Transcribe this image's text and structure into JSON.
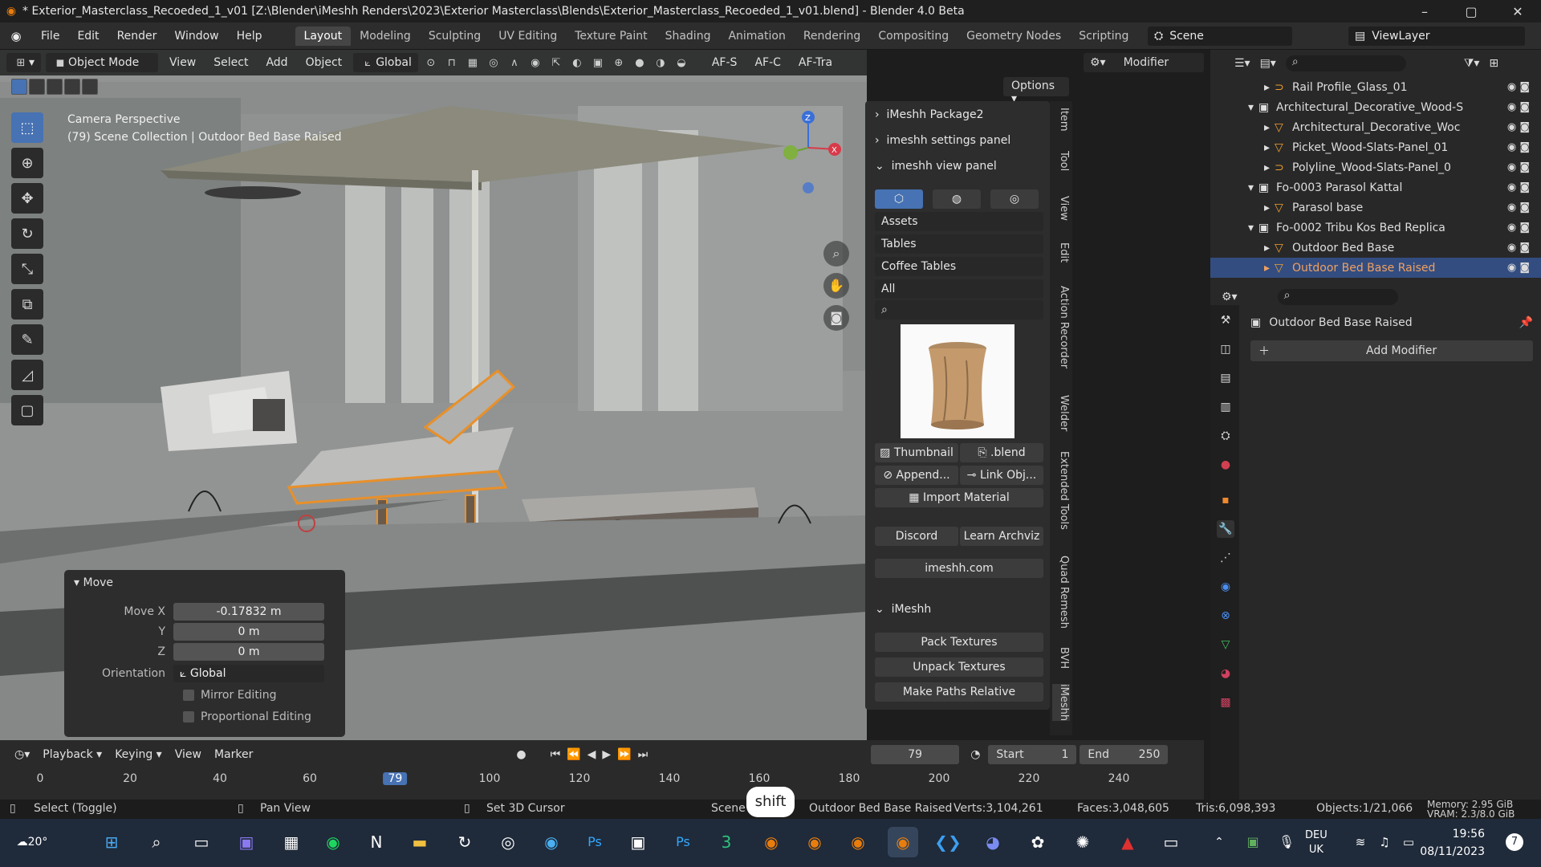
{
  "window": {
    "title": "* Exterior_Masterclass_Recoeded_1_v01 [Z:\\Blender\\iMeshh Renders\\2023\\Exterior Masterclass\\Blends\\Exterior_Masterclass_Recoeded_1_v01.blend] - Blender 4.0 Beta",
    "minimize": "–",
    "maximize": "▢",
    "close": "✕"
  },
  "menu": [
    "File",
    "Edit",
    "Render",
    "Window",
    "Help"
  ],
  "workspaces": [
    "Layout",
    "Modeling",
    "Sculpting",
    "UV Editing",
    "Texture Paint",
    "Shading",
    "Animation",
    "Rendering",
    "Compositing",
    "Geometry Nodes",
    "Scripting"
  ],
  "active_workspace": "Layout",
  "add_workspace": "+",
  "scene": {
    "name": "Scene",
    "view_layer": "ViewLayer"
  },
  "viewport_header": {
    "mode": "Object Mode",
    "menus": [
      "View",
      "Select",
      "Add",
      "Object"
    ],
    "orientation": "Global",
    "af_s": "AF-S",
    "af_c": "AF-C",
    "af_tra": "AF-Tra"
  },
  "viewport": {
    "perspective": "Camera Perspective",
    "collection_line": "(79) Scene Collection | Outdoor Bed Base Raised",
    "options": "Options"
  },
  "move_panel": {
    "title": "Move",
    "move_x_label": "Move X",
    "move_x": "-0.17832 m",
    "y_label": "Y",
    "y": "0 m",
    "z_label": "Z",
    "z": "0 m",
    "orientation_label": "Orientation",
    "orientation": "Global",
    "mirror": "Mirror Editing",
    "proportional": "Proportional Editing"
  },
  "npanel": {
    "package": "iMeshh Package2",
    "settings": "imeshh settings panel",
    "view_panel": "imeshh view panel",
    "drop1": "Assets",
    "drop2": "Tables",
    "drop3": "Coffee Tables",
    "drop4": "All",
    "thumbnail": "Thumbnail",
    "blend": ".blend",
    "append": "Append...",
    "link": "Link Obj...",
    "import_material": "Import Material",
    "discord": "Discord",
    "learn": "Learn Archviz",
    "site": "imeshh.com",
    "imeshh": "iMeshh",
    "pack": "Pack Textures",
    "unpack": "Unpack Textures",
    "paths": "Make Paths Relative"
  },
  "side_tabs": [
    "Item",
    "Tool",
    "View",
    "Edit",
    "Action Recorder",
    "Welder",
    "Extended Tools",
    "Quad Remesh",
    "BVH",
    "iMeshh"
  ],
  "editor_type": {
    "label": "Modifier"
  },
  "outliner": [
    {
      "label": "Rail Profile_Glass_01",
      "indent": 3,
      "icon": "⊃"
    },
    {
      "label": "Architectural_Decorative_Wood-S",
      "indent": 2,
      "icon": "▣"
    },
    {
      "label": "Architectural_Decorative_Woc",
      "indent": 3,
      "icon": "▽"
    },
    {
      "label": "Picket_Wood-Slats-Panel_01",
      "indent": 3,
      "icon": "▽"
    },
    {
      "label": "Polyline_Wood-Slats-Panel_0",
      "indent": 3,
      "icon": "⊃"
    },
    {
      "label": "Fo-0003 Parasol Kattal",
      "indent": 2,
      "icon": "▣"
    },
    {
      "label": "Parasol base",
      "indent": 3,
      "icon": "▽"
    },
    {
      "label": "Fo-0002 Tribu Kos Bed Replica",
      "indent": 2,
      "icon": "▣"
    },
    {
      "label": "Outdoor Bed Base",
      "indent": 3,
      "icon": "▽"
    },
    {
      "label": "Outdoor Bed Base Raised",
      "indent": 3,
      "icon": "▽",
      "selected": true
    }
  ],
  "properties": {
    "object_name": "Outdoor Bed Base Raised",
    "add_modifier": "Add Modifier"
  },
  "timeline": {
    "menus": [
      "Playback",
      "Keying",
      "View",
      "Marker"
    ],
    "current_frame": "79",
    "start_label": "Start",
    "start": "1",
    "end_label": "End",
    "end": "250",
    "ticks": [
      "0",
      "20",
      "40",
      "60",
      "79",
      "100",
      "120",
      "140",
      "160",
      "180",
      "200",
      "220",
      "240"
    ]
  },
  "statusbar": {
    "select": "Select (Toggle)",
    "pan": "Pan View",
    "cursor": "Set 3D Cursor",
    "scene": "Scene",
    "object": "Outdoor Bed Base Raised",
    "verts": "Verts:3,104,261",
    "faces": "Faces:3,048,605",
    "tris": "Tris:6,098,393",
    "objects": "Objects:1/21,066",
    "memory": "Memory: 2.95 GiB",
    "vram": "VRAM: 2.3/8.0 GiB"
  },
  "key_overlay": "shift",
  "taskbar": {
    "weather": "20°",
    "language": "DEU",
    "region": "UK",
    "time": "19:56",
    "date": "08/11/2023",
    "notifications": "7"
  },
  "colors": {
    "accent": "#4772b3",
    "selection": "#f0a030",
    "active_tab": "#454545"
  }
}
